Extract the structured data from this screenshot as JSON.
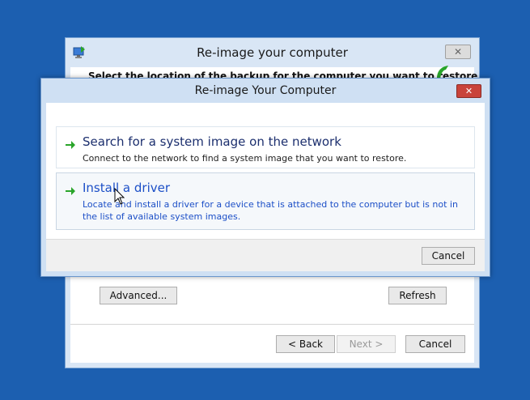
{
  "back_window": {
    "title": "Re-image your computer",
    "heading": "Select the location of the backup for the computer you want to restore",
    "advanced_label": "Advanced...",
    "refresh_label": "Refresh",
    "back_label": "< Back",
    "next_label": "Next >",
    "cancel_label": "Cancel"
  },
  "dialog": {
    "title": "Re-image Your Computer",
    "options": [
      {
        "title": "Search for a system image on the network",
        "description": "Connect to the network to find a system image that you want to restore."
      },
      {
        "title": "Install a driver",
        "description": "Locate and install a driver for a device that is attached to the computer but is not in the list of available system images."
      }
    ],
    "cancel_label": "Cancel"
  },
  "colors": {
    "desktop": "#1c5fb0",
    "link_blue": "#1c4fc7",
    "arrow_green": "#2aa52a",
    "close_red": "#c9433a"
  },
  "icons": [
    "computer-restore-icon",
    "close-icon",
    "green-arrow-icon",
    "mouse-cursor-icon"
  ]
}
